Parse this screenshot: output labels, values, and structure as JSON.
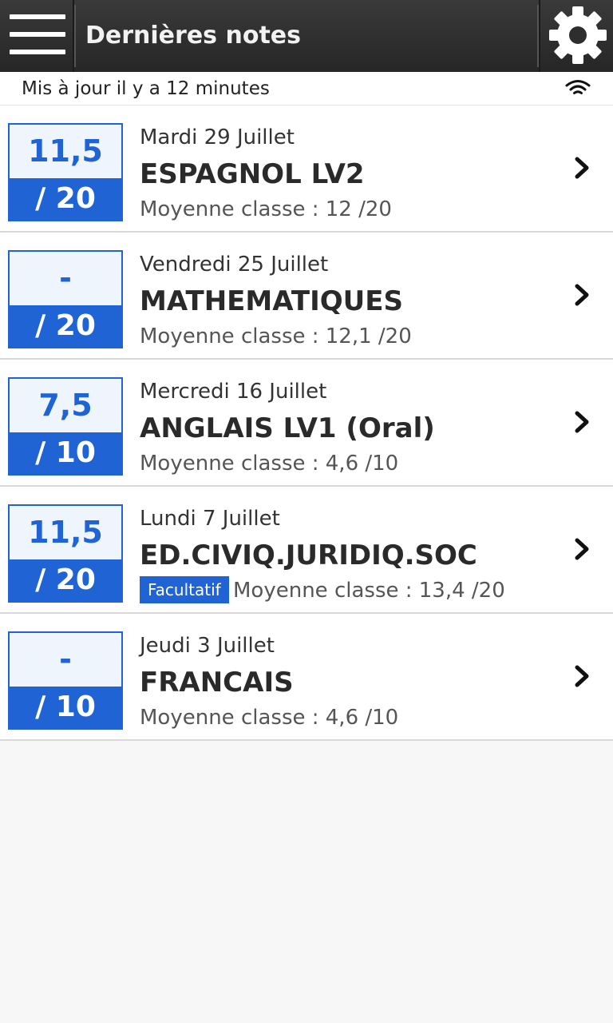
{
  "header": {
    "title": "Dernières notes",
    "menu_icon": "hamburger-menu-icon",
    "settings_icon": "gear-icon"
  },
  "status": {
    "text": "Mis à jour il y a 12 minutes",
    "icon": "wifi-icon"
  },
  "colors": {
    "accent": "#1f63d4",
    "score_bg": "#eef5fd",
    "topbar": "#2e2e2e"
  },
  "grades": [
    {
      "score": "11,5",
      "max": "/ 20",
      "date": "Mardi 29 Juillet",
      "subject": "ESPAGNOL LV2",
      "average": "Moyenne classe : 12 /20",
      "badge": ""
    },
    {
      "score": "-",
      "max": "/ 20",
      "date": "Vendredi 25 Juillet",
      "subject": "MATHEMATIQUES",
      "average": "Moyenne classe : 12,1 /20",
      "badge": ""
    },
    {
      "score": "7,5",
      "max": "/ 10",
      "date": "Mercredi 16 Juillet",
      "subject": "ANGLAIS LV1 (Oral)",
      "average": "Moyenne classe : 4,6 /10",
      "badge": ""
    },
    {
      "score": "11,5",
      "max": "/ 20",
      "date": "Lundi 7 Juillet",
      "subject": "ED.CIVIQ.JURIDIQ.SOC",
      "average": "Moyenne classe : 13,4 /20",
      "badge": "Facultatif"
    },
    {
      "score": "-",
      "max": "/ 10",
      "date": "Jeudi 3 Juillet",
      "subject": "FRANCAIS",
      "average": "Moyenne classe : 4,6 /10",
      "badge": ""
    }
  ]
}
